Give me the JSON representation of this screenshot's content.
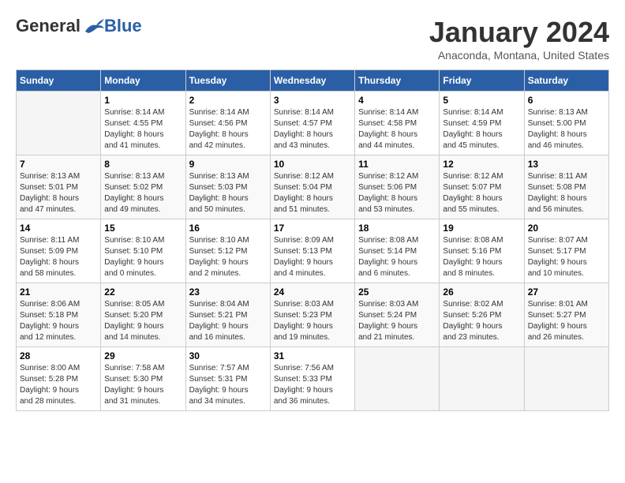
{
  "header": {
    "logo": {
      "general": "General",
      "blue": "Blue"
    },
    "title": "January 2024",
    "location": "Anaconda, Montana, United States"
  },
  "days_of_week": [
    "Sunday",
    "Monday",
    "Tuesday",
    "Wednesday",
    "Thursday",
    "Friday",
    "Saturday"
  ],
  "weeks": [
    [
      {
        "day": "",
        "info": ""
      },
      {
        "day": "1",
        "info": "Sunrise: 8:14 AM\nSunset: 4:55 PM\nDaylight: 8 hours\nand 41 minutes."
      },
      {
        "day": "2",
        "info": "Sunrise: 8:14 AM\nSunset: 4:56 PM\nDaylight: 8 hours\nand 42 minutes."
      },
      {
        "day": "3",
        "info": "Sunrise: 8:14 AM\nSunset: 4:57 PM\nDaylight: 8 hours\nand 43 minutes."
      },
      {
        "day": "4",
        "info": "Sunrise: 8:14 AM\nSunset: 4:58 PM\nDaylight: 8 hours\nand 44 minutes."
      },
      {
        "day": "5",
        "info": "Sunrise: 8:14 AM\nSunset: 4:59 PM\nDaylight: 8 hours\nand 45 minutes."
      },
      {
        "day": "6",
        "info": "Sunrise: 8:13 AM\nSunset: 5:00 PM\nDaylight: 8 hours\nand 46 minutes."
      }
    ],
    [
      {
        "day": "7",
        "info": "Sunrise: 8:13 AM\nSunset: 5:01 PM\nDaylight: 8 hours\nand 47 minutes."
      },
      {
        "day": "8",
        "info": "Sunrise: 8:13 AM\nSunset: 5:02 PM\nDaylight: 8 hours\nand 49 minutes."
      },
      {
        "day": "9",
        "info": "Sunrise: 8:13 AM\nSunset: 5:03 PM\nDaylight: 8 hours\nand 50 minutes."
      },
      {
        "day": "10",
        "info": "Sunrise: 8:12 AM\nSunset: 5:04 PM\nDaylight: 8 hours\nand 51 minutes."
      },
      {
        "day": "11",
        "info": "Sunrise: 8:12 AM\nSunset: 5:06 PM\nDaylight: 8 hours\nand 53 minutes."
      },
      {
        "day": "12",
        "info": "Sunrise: 8:12 AM\nSunset: 5:07 PM\nDaylight: 8 hours\nand 55 minutes."
      },
      {
        "day": "13",
        "info": "Sunrise: 8:11 AM\nSunset: 5:08 PM\nDaylight: 8 hours\nand 56 minutes."
      }
    ],
    [
      {
        "day": "14",
        "info": "Sunrise: 8:11 AM\nSunset: 5:09 PM\nDaylight: 8 hours\nand 58 minutes."
      },
      {
        "day": "15",
        "info": "Sunrise: 8:10 AM\nSunset: 5:10 PM\nDaylight: 9 hours\nand 0 minutes."
      },
      {
        "day": "16",
        "info": "Sunrise: 8:10 AM\nSunset: 5:12 PM\nDaylight: 9 hours\nand 2 minutes."
      },
      {
        "day": "17",
        "info": "Sunrise: 8:09 AM\nSunset: 5:13 PM\nDaylight: 9 hours\nand 4 minutes."
      },
      {
        "day": "18",
        "info": "Sunrise: 8:08 AM\nSunset: 5:14 PM\nDaylight: 9 hours\nand 6 minutes."
      },
      {
        "day": "19",
        "info": "Sunrise: 8:08 AM\nSunset: 5:16 PM\nDaylight: 9 hours\nand 8 minutes."
      },
      {
        "day": "20",
        "info": "Sunrise: 8:07 AM\nSunset: 5:17 PM\nDaylight: 9 hours\nand 10 minutes."
      }
    ],
    [
      {
        "day": "21",
        "info": "Sunrise: 8:06 AM\nSunset: 5:18 PM\nDaylight: 9 hours\nand 12 minutes."
      },
      {
        "day": "22",
        "info": "Sunrise: 8:05 AM\nSunset: 5:20 PM\nDaylight: 9 hours\nand 14 minutes."
      },
      {
        "day": "23",
        "info": "Sunrise: 8:04 AM\nSunset: 5:21 PM\nDaylight: 9 hours\nand 16 minutes."
      },
      {
        "day": "24",
        "info": "Sunrise: 8:03 AM\nSunset: 5:23 PM\nDaylight: 9 hours\nand 19 minutes."
      },
      {
        "day": "25",
        "info": "Sunrise: 8:03 AM\nSunset: 5:24 PM\nDaylight: 9 hours\nand 21 minutes."
      },
      {
        "day": "26",
        "info": "Sunrise: 8:02 AM\nSunset: 5:26 PM\nDaylight: 9 hours\nand 23 minutes."
      },
      {
        "day": "27",
        "info": "Sunrise: 8:01 AM\nSunset: 5:27 PM\nDaylight: 9 hours\nand 26 minutes."
      }
    ],
    [
      {
        "day": "28",
        "info": "Sunrise: 8:00 AM\nSunset: 5:28 PM\nDaylight: 9 hours\nand 28 minutes."
      },
      {
        "day": "29",
        "info": "Sunrise: 7:58 AM\nSunset: 5:30 PM\nDaylight: 9 hours\nand 31 minutes."
      },
      {
        "day": "30",
        "info": "Sunrise: 7:57 AM\nSunset: 5:31 PM\nDaylight: 9 hours\nand 34 minutes."
      },
      {
        "day": "31",
        "info": "Sunrise: 7:56 AM\nSunset: 5:33 PM\nDaylight: 9 hours\nand 36 minutes."
      },
      {
        "day": "",
        "info": ""
      },
      {
        "day": "",
        "info": ""
      },
      {
        "day": "",
        "info": ""
      }
    ]
  ]
}
